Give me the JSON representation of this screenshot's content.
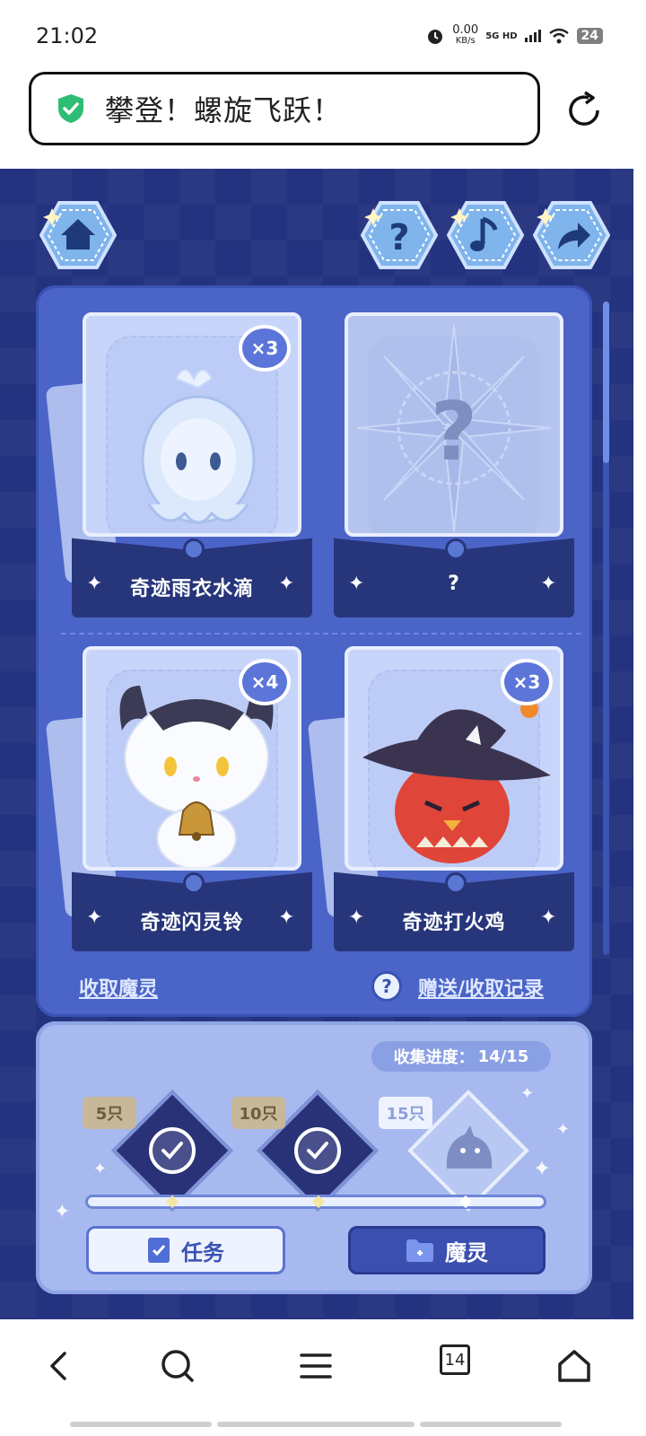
{
  "status_bar": {
    "time": "21:02",
    "net_speed": "0.00",
    "net_unit": "KB/s",
    "signal": "5G HD",
    "battery": "24"
  },
  "browser": {
    "url_text": "攀登！螺旋飞跃！",
    "reload_icon": "reload-icon"
  },
  "game": {
    "top_buttons": [
      "home-icon",
      "help-icon",
      "music-icon",
      "share-icon"
    ],
    "cards": [
      {
        "name": "奇迹雨衣水滴",
        "count": "×3"
      },
      {
        "name": "?",
        "count": ""
      },
      {
        "name": "奇迹闪灵铃",
        "count": "×4"
      },
      {
        "name": "奇迹打火鸡",
        "count": "×3"
      }
    ],
    "links": {
      "collect": "收取魔灵",
      "records": "赠送/收取记录",
      "help_mark": "?"
    },
    "progress": {
      "label": "收集进度：",
      "value": "14/15",
      "current": 14,
      "total": 15,
      "milestones": [
        {
          "label": "5只",
          "completed": true
        },
        {
          "label": "10只",
          "completed": true
        },
        {
          "label": "15只",
          "completed": false
        }
      ]
    },
    "buttons": {
      "task": "任务",
      "spirit": "魔灵"
    }
  },
  "nav": {
    "tabs_count": "14",
    "icons": [
      "back-icon",
      "search-icon",
      "menu-icon",
      "tabs-icon",
      "home-icon"
    ]
  }
}
